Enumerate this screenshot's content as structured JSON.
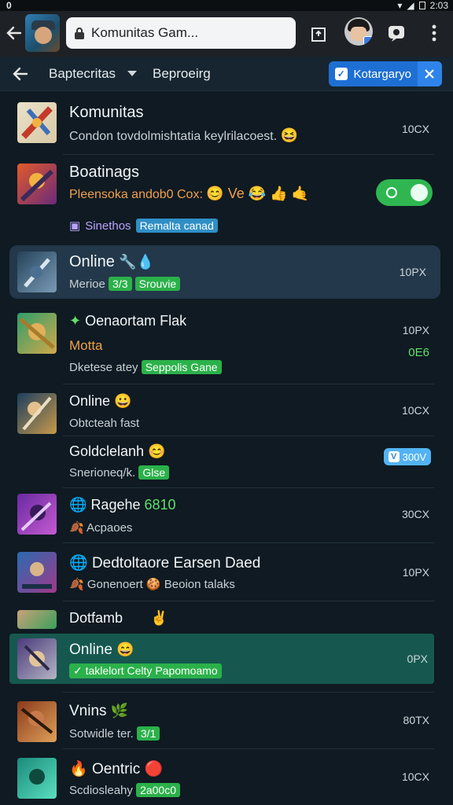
{
  "statusbar": {
    "left": "0",
    "time": "2:03"
  },
  "browser": {
    "address": "Komunitas Gam..."
  },
  "subbar": {
    "menu1": "Baptecritas",
    "menu2": "Beproeirg",
    "pill_label": "Kotargaryo"
  },
  "rows": [
    {
      "title": "Komunitas",
      "sub": "Condon tovdolmishtatia keylrilacoest.",
      "sub_emoji": "😆",
      "right": "10CX"
    },
    {
      "title": "Boatinags",
      "sub": "Pleensoka andob0 Cox:",
      "sub_emoji": "😊 Ve 😂 👍 🤙",
      "extra_label": "Sinethos",
      "extra_tag": "Remalta canad"
    },
    {
      "title": "Online",
      "title_emoji": "🔧💧",
      "sub": "Merioe",
      "sub_tag1": "3/3",
      "sub_tag2": "Srouvie",
      "right": "10PX"
    },
    {
      "title": "Oenaortam Flak",
      "sub_orange": "Motta",
      "sub": "Dketese atey",
      "sub_tag": "Seppolis Gane",
      "right": "10PX",
      "right_green": "0E6"
    },
    {
      "title": "Online",
      "title_emoji": "😀",
      "sub": "Obtcteah fast",
      "right": "10CX"
    },
    {
      "title": "Goldclelanh",
      "title_emoji": "😊",
      "sub": "Snerioneq/k.",
      "sub_tag": "Glse",
      "badge": "300V"
    },
    {
      "title": "Ragehe",
      "title_green": "6810",
      "sub": "Acpaoes",
      "right": "30CX"
    },
    {
      "title": "Dedtoltaore Earsen Daed",
      "sub": "Gonenoert",
      "sub2": "Beoion talaks",
      "right": "10PX"
    },
    {
      "title": "Dotfamb"
    },
    {
      "title": "Online",
      "title_emoji": "😄",
      "sub_tag": "taklelort Celty Papomoamo",
      "right": "0PX"
    },
    {
      "title": "Vnins",
      "title_emoji": "🌿",
      "sub": "Sotwidle ter.",
      "sub_tag": "3/1",
      "right": "80TX"
    },
    {
      "title": "Oentric",
      "sub": "Scdiosleahy",
      "sub_tag": "2a00c0",
      "right": "10CX"
    }
  ],
  "colors": {
    "accent_blue": "#1e6fd4",
    "tag_green": "#2bb14a",
    "row_highlight": "#23384a",
    "row_highlight_teal": "#16584f"
  }
}
